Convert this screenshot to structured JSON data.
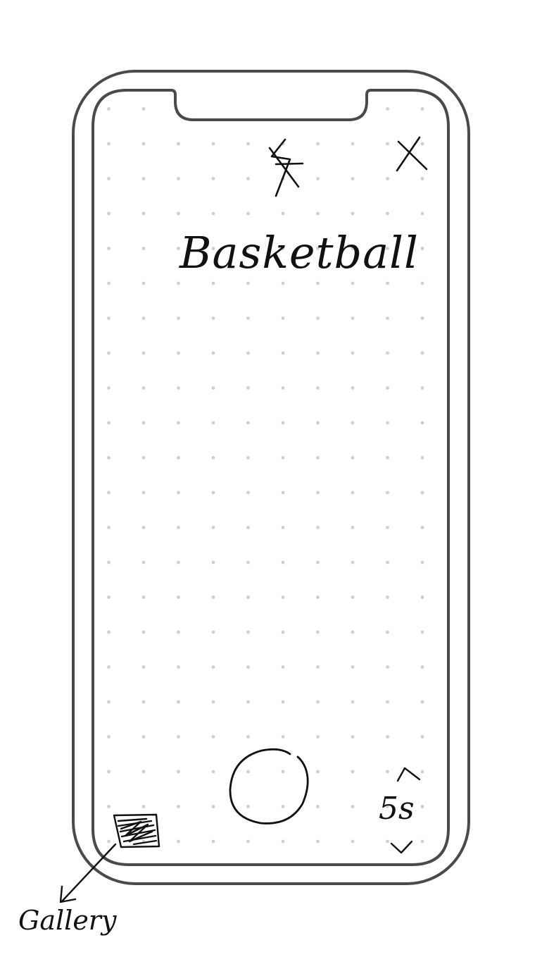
{
  "screen": {
    "title": "Basketball"
  },
  "toolbar": {
    "flash_icon": "flash-off-icon",
    "close_icon": "close-icon"
  },
  "camera": {
    "shutter_icon": "shutter-button-circle",
    "timer": {
      "value": "5s",
      "increase_icon": "chevron-up-icon",
      "decrease_icon": "chevron-down-icon"
    },
    "gallery": {
      "thumbnail_icon": "gallery-thumbnail-icon",
      "annotation_label": "Gallery"
    }
  }
}
